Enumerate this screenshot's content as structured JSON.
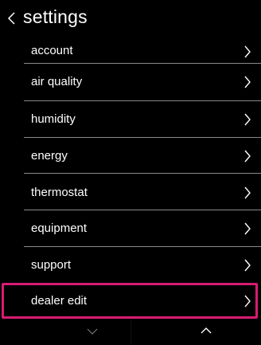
{
  "header": {
    "title": "settings",
    "back_icon": "chevron-left-icon"
  },
  "menu": {
    "items": [
      {
        "label": "account"
      },
      {
        "label": "air quality"
      },
      {
        "label": "humidity"
      },
      {
        "label": "energy"
      },
      {
        "label": "thermostat"
      },
      {
        "label": "equipment"
      },
      {
        "label": "support"
      },
      {
        "label": "dealer edit",
        "selected": true
      }
    ],
    "item_icon": "chevron-right-icon"
  },
  "footer": {
    "scroll_down_icon": "chevron-down-icon",
    "scroll_up_icon": "chevron-up-icon"
  },
  "colors": {
    "background": "#000000",
    "text": "#ffffff",
    "divider": "#8a8a8a",
    "selection": "#d81b73"
  }
}
